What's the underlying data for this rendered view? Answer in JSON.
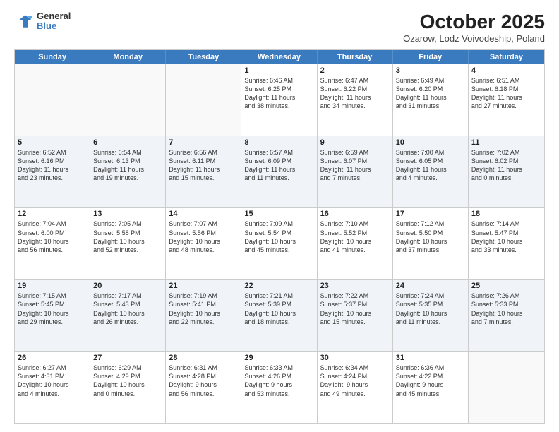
{
  "logo": {
    "general": "General",
    "blue": "Blue"
  },
  "header": {
    "month": "October 2025",
    "location": "Ozarow, Lodz Voivodeship, Poland"
  },
  "weekdays": [
    "Sunday",
    "Monday",
    "Tuesday",
    "Wednesday",
    "Thursday",
    "Friday",
    "Saturday"
  ],
  "rows": [
    {
      "alt": false,
      "cells": [
        {
          "day": "",
          "text": ""
        },
        {
          "day": "",
          "text": ""
        },
        {
          "day": "",
          "text": ""
        },
        {
          "day": "1",
          "text": "Sunrise: 6:46 AM\nSunset: 6:25 PM\nDaylight: 11 hours\nand 38 minutes."
        },
        {
          "day": "2",
          "text": "Sunrise: 6:47 AM\nSunset: 6:22 PM\nDaylight: 11 hours\nand 34 minutes."
        },
        {
          "day": "3",
          "text": "Sunrise: 6:49 AM\nSunset: 6:20 PM\nDaylight: 11 hours\nand 31 minutes."
        },
        {
          "day": "4",
          "text": "Sunrise: 6:51 AM\nSunset: 6:18 PM\nDaylight: 11 hours\nand 27 minutes."
        }
      ]
    },
    {
      "alt": true,
      "cells": [
        {
          "day": "5",
          "text": "Sunrise: 6:52 AM\nSunset: 6:16 PM\nDaylight: 11 hours\nand 23 minutes."
        },
        {
          "day": "6",
          "text": "Sunrise: 6:54 AM\nSunset: 6:13 PM\nDaylight: 11 hours\nand 19 minutes."
        },
        {
          "day": "7",
          "text": "Sunrise: 6:56 AM\nSunset: 6:11 PM\nDaylight: 11 hours\nand 15 minutes."
        },
        {
          "day": "8",
          "text": "Sunrise: 6:57 AM\nSunset: 6:09 PM\nDaylight: 11 hours\nand 11 minutes."
        },
        {
          "day": "9",
          "text": "Sunrise: 6:59 AM\nSunset: 6:07 PM\nDaylight: 11 hours\nand 7 minutes."
        },
        {
          "day": "10",
          "text": "Sunrise: 7:00 AM\nSunset: 6:05 PM\nDaylight: 11 hours\nand 4 minutes."
        },
        {
          "day": "11",
          "text": "Sunrise: 7:02 AM\nSunset: 6:02 PM\nDaylight: 11 hours\nand 0 minutes."
        }
      ]
    },
    {
      "alt": false,
      "cells": [
        {
          "day": "12",
          "text": "Sunrise: 7:04 AM\nSunset: 6:00 PM\nDaylight: 10 hours\nand 56 minutes."
        },
        {
          "day": "13",
          "text": "Sunrise: 7:05 AM\nSunset: 5:58 PM\nDaylight: 10 hours\nand 52 minutes."
        },
        {
          "day": "14",
          "text": "Sunrise: 7:07 AM\nSunset: 5:56 PM\nDaylight: 10 hours\nand 48 minutes."
        },
        {
          "day": "15",
          "text": "Sunrise: 7:09 AM\nSunset: 5:54 PM\nDaylight: 10 hours\nand 45 minutes."
        },
        {
          "day": "16",
          "text": "Sunrise: 7:10 AM\nSunset: 5:52 PM\nDaylight: 10 hours\nand 41 minutes."
        },
        {
          "day": "17",
          "text": "Sunrise: 7:12 AM\nSunset: 5:50 PM\nDaylight: 10 hours\nand 37 minutes."
        },
        {
          "day": "18",
          "text": "Sunrise: 7:14 AM\nSunset: 5:47 PM\nDaylight: 10 hours\nand 33 minutes."
        }
      ]
    },
    {
      "alt": true,
      "cells": [
        {
          "day": "19",
          "text": "Sunrise: 7:15 AM\nSunset: 5:45 PM\nDaylight: 10 hours\nand 29 minutes."
        },
        {
          "day": "20",
          "text": "Sunrise: 7:17 AM\nSunset: 5:43 PM\nDaylight: 10 hours\nand 26 minutes."
        },
        {
          "day": "21",
          "text": "Sunrise: 7:19 AM\nSunset: 5:41 PM\nDaylight: 10 hours\nand 22 minutes."
        },
        {
          "day": "22",
          "text": "Sunrise: 7:21 AM\nSunset: 5:39 PM\nDaylight: 10 hours\nand 18 minutes."
        },
        {
          "day": "23",
          "text": "Sunrise: 7:22 AM\nSunset: 5:37 PM\nDaylight: 10 hours\nand 15 minutes."
        },
        {
          "day": "24",
          "text": "Sunrise: 7:24 AM\nSunset: 5:35 PM\nDaylight: 10 hours\nand 11 minutes."
        },
        {
          "day": "25",
          "text": "Sunrise: 7:26 AM\nSunset: 5:33 PM\nDaylight: 10 hours\nand 7 minutes."
        }
      ]
    },
    {
      "alt": false,
      "cells": [
        {
          "day": "26",
          "text": "Sunrise: 6:27 AM\nSunset: 4:31 PM\nDaylight: 10 hours\nand 4 minutes."
        },
        {
          "day": "27",
          "text": "Sunrise: 6:29 AM\nSunset: 4:29 PM\nDaylight: 10 hours\nand 0 minutes."
        },
        {
          "day": "28",
          "text": "Sunrise: 6:31 AM\nSunset: 4:28 PM\nDaylight: 9 hours\nand 56 minutes."
        },
        {
          "day": "29",
          "text": "Sunrise: 6:33 AM\nSunset: 4:26 PM\nDaylight: 9 hours\nand 53 minutes."
        },
        {
          "day": "30",
          "text": "Sunrise: 6:34 AM\nSunset: 4:24 PM\nDaylight: 9 hours\nand 49 minutes."
        },
        {
          "day": "31",
          "text": "Sunrise: 6:36 AM\nSunset: 4:22 PM\nDaylight: 9 hours\nand 45 minutes."
        },
        {
          "day": "",
          "text": ""
        }
      ]
    }
  ]
}
